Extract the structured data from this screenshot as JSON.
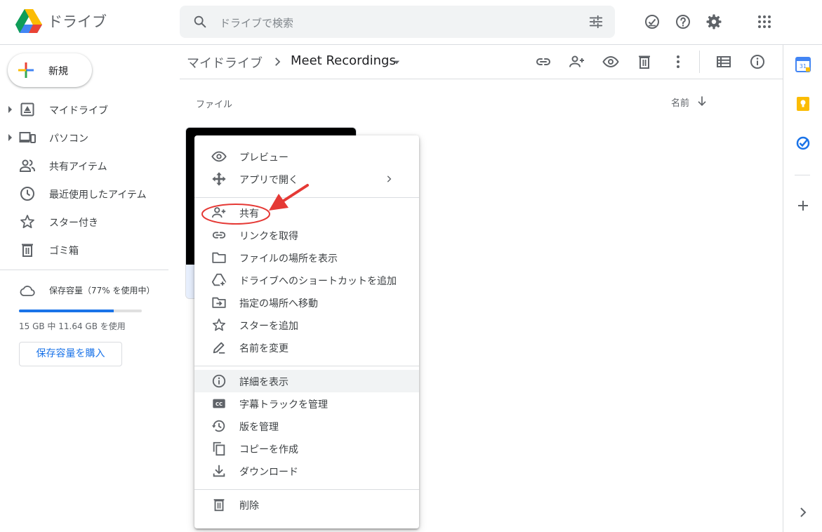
{
  "header": {
    "app_title": "ドライブ",
    "search_placeholder": "ドライブで検索"
  },
  "sidebar": {
    "new_label": "新規",
    "items": [
      {
        "label": "マイドライブ",
        "icon": "my-drive-icon"
      },
      {
        "label": "パソコン",
        "icon": "computers-icon"
      },
      {
        "label": "共有アイテム",
        "icon": "shared-icon"
      },
      {
        "label": "最近使用したアイテム",
        "icon": "recent-icon"
      },
      {
        "label": "スター付き",
        "icon": "star-icon"
      },
      {
        "label": "ゴミ箱",
        "icon": "trash-icon"
      }
    ],
    "storage": {
      "label": "保存容量（77% を使用中）",
      "usage_text": "15 GB 中 11.64 GB を使用",
      "used_fraction": 0.77,
      "buy_label": "保存容量を購入"
    }
  },
  "main": {
    "breadcrumb_root": "マイドライブ",
    "breadcrumb_current": "Meet Recordings",
    "files_label": "ファイル",
    "sort_label": "名前"
  },
  "menu": {
    "items": [
      {
        "label": "プレビュー",
        "icon": "eye-icon"
      },
      {
        "label": "アプリで開く",
        "icon": "open-with-icon"
      },
      {
        "label": "共有",
        "icon": "share-person-icon"
      },
      {
        "label": "リンクを取得",
        "icon": "link-icon"
      },
      {
        "label": "ファイルの場所を表示",
        "icon": "folder-icon"
      },
      {
        "label": "ドライブへのショートカットを追加",
        "icon": "add-shortcut-icon"
      },
      {
        "label": "指定の場所へ移動",
        "icon": "move-to-icon"
      },
      {
        "label": "スターを追加",
        "icon": "star-outline-icon"
      },
      {
        "label": "名前を変更",
        "icon": "pencil-icon"
      },
      {
        "label": "詳細を表示",
        "icon": "info-icon"
      },
      {
        "label": "字幕トラックを管理",
        "icon": "closed-caption-icon"
      },
      {
        "label": "版を管理",
        "icon": "history-icon"
      },
      {
        "label": "コピーを作成",
        "icon": "copy-icon"
      },
      {
        "label": "ダウンロード",
        "icon": "download-icon"
      },
      {
        "label": "削除",
        "icon": "trash-icon"
      }
    ]
  },
  "colors": {
    "accent": "#1a73e8",
    "annotation_red": "#e53935",
    "highlight_row": "#f1f3f4"
  }
}
